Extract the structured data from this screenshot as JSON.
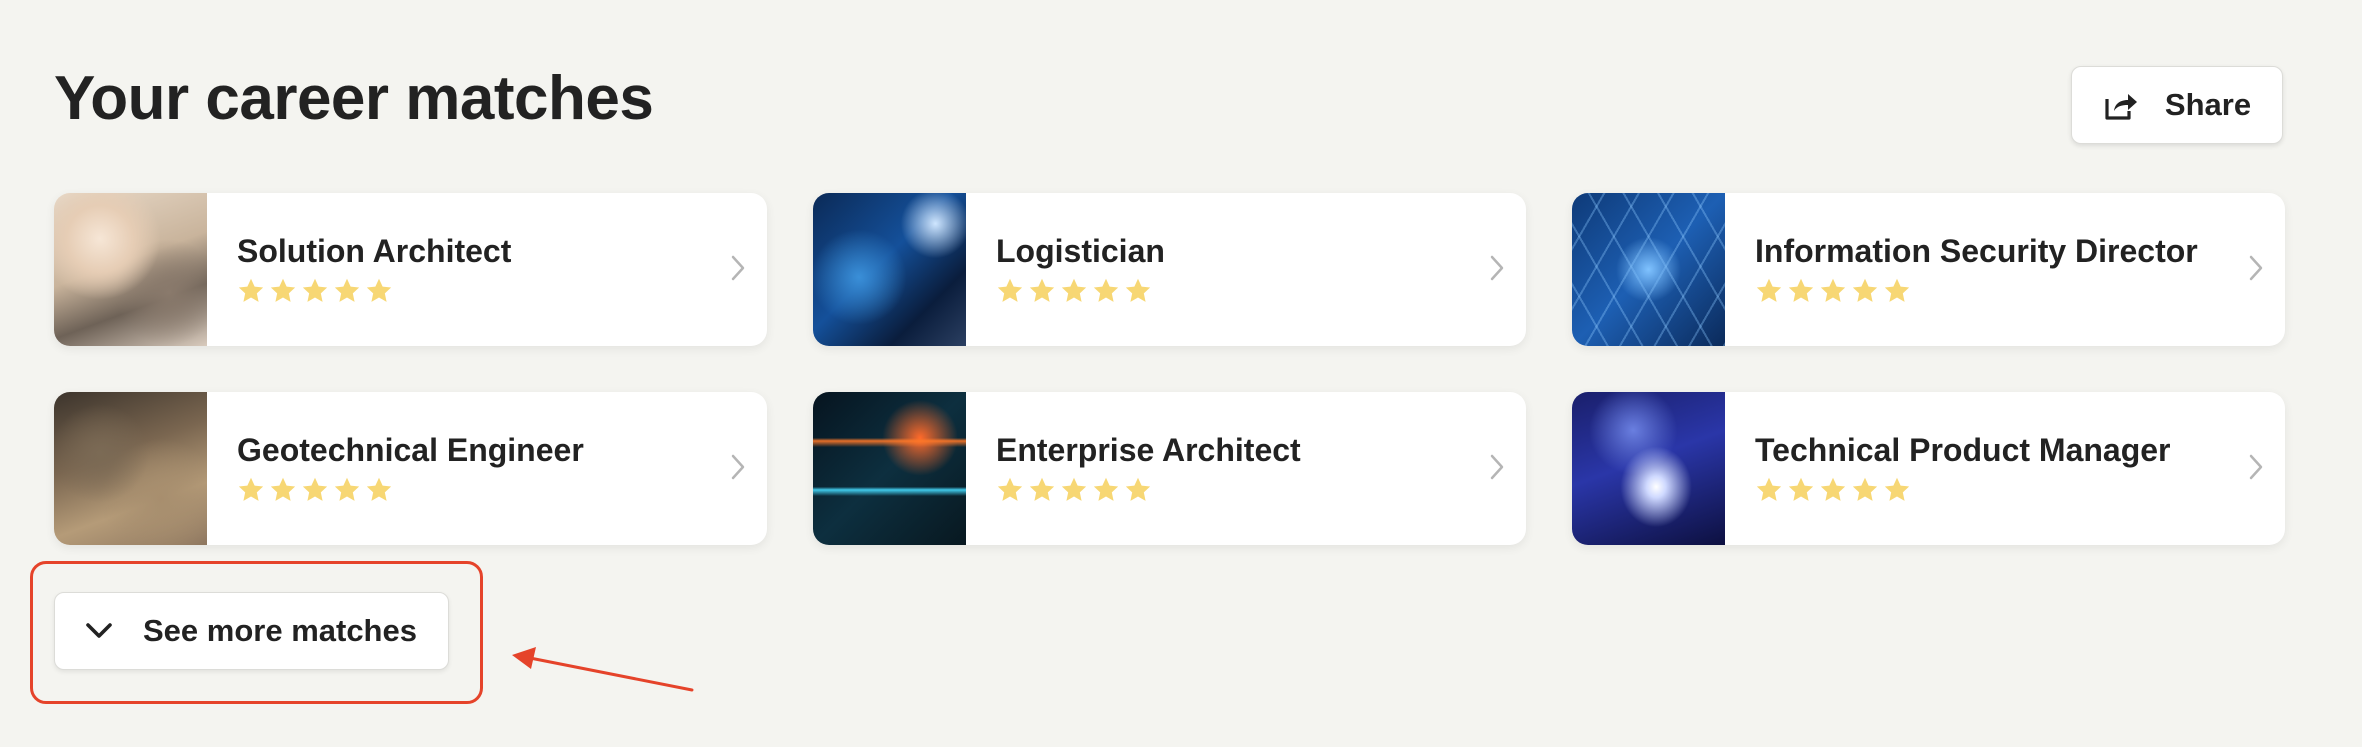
{
  "header": {
    "title": "Your career matches",
    "share_label": "Share"
  },
  "matches": [
    {
      "title": "Solution Architect",
      "rating": 5
    },
    {
      "title": "Logistician",
      "rating": 5
    },
    {
      "title": "Information Security Director",
      "rating": 5
    },
    {
      "title": "Geotechnical Engineer",
      "rating": 5
    },
    {
      "title": "Enterprise Architect",
      "rating": 5
    },
    {
      "title": "Technical Product Manager",
      "rating": 5
    }
  ],
  "see_more": {
    "label": "See more matches"
  },
  "icons": {
    "share": "share-icon",
    "chevron_right": "chevron-right-icon",
    "chevron_down": "chevron-down-icon",
    "star": "star-icon"
  },
  "colors": {
    "background": "#f4f4f0",
    "star": "#f7d774",
    "annotation": "#e5432a"
  }
}
